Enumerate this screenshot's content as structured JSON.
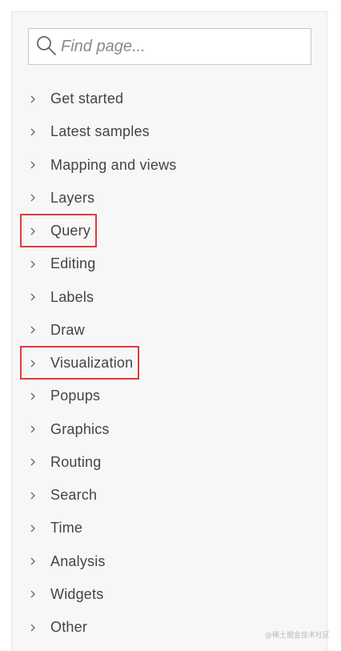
{
  "search": {
    "placeholder": "Find page..."
  },
  "nav": {
    "items": [
      {
        "label": "Get started"
      },
      {
        "label": "Latest samples"
      },
      {
        "label": "Mapping and views"
      },
      {
        "label": "Layers"
      },
      {
        "label": "Query",
        "highlighted": true
      },
      {
        "label": "Editing"
      },
      {
        "label": "Labels"
      },
      {
        "label": "Draw"
      },
      {
        "label": "Visualization",
        "highlighted": true
      },
      {
        "label": "Popups"
      },
      {
        "label": "Graphics"
      },
      {
        "label": "Routing"
      },
      {
        "label": "Search"
      },
      {
        "label": "Time"
      },
      {
        "label": "Analysis"
      },
      {
        "label": "Widgets"
      },
      {
        "label": "Other"
      }
    ]
  },
  "colors": {
    "highlight": "#e03c3c",
    "text": "#444444",
    "panel_bg": "#f7f7f7"
  },
  "watermark": "@稀土掘金技术社区"
}
